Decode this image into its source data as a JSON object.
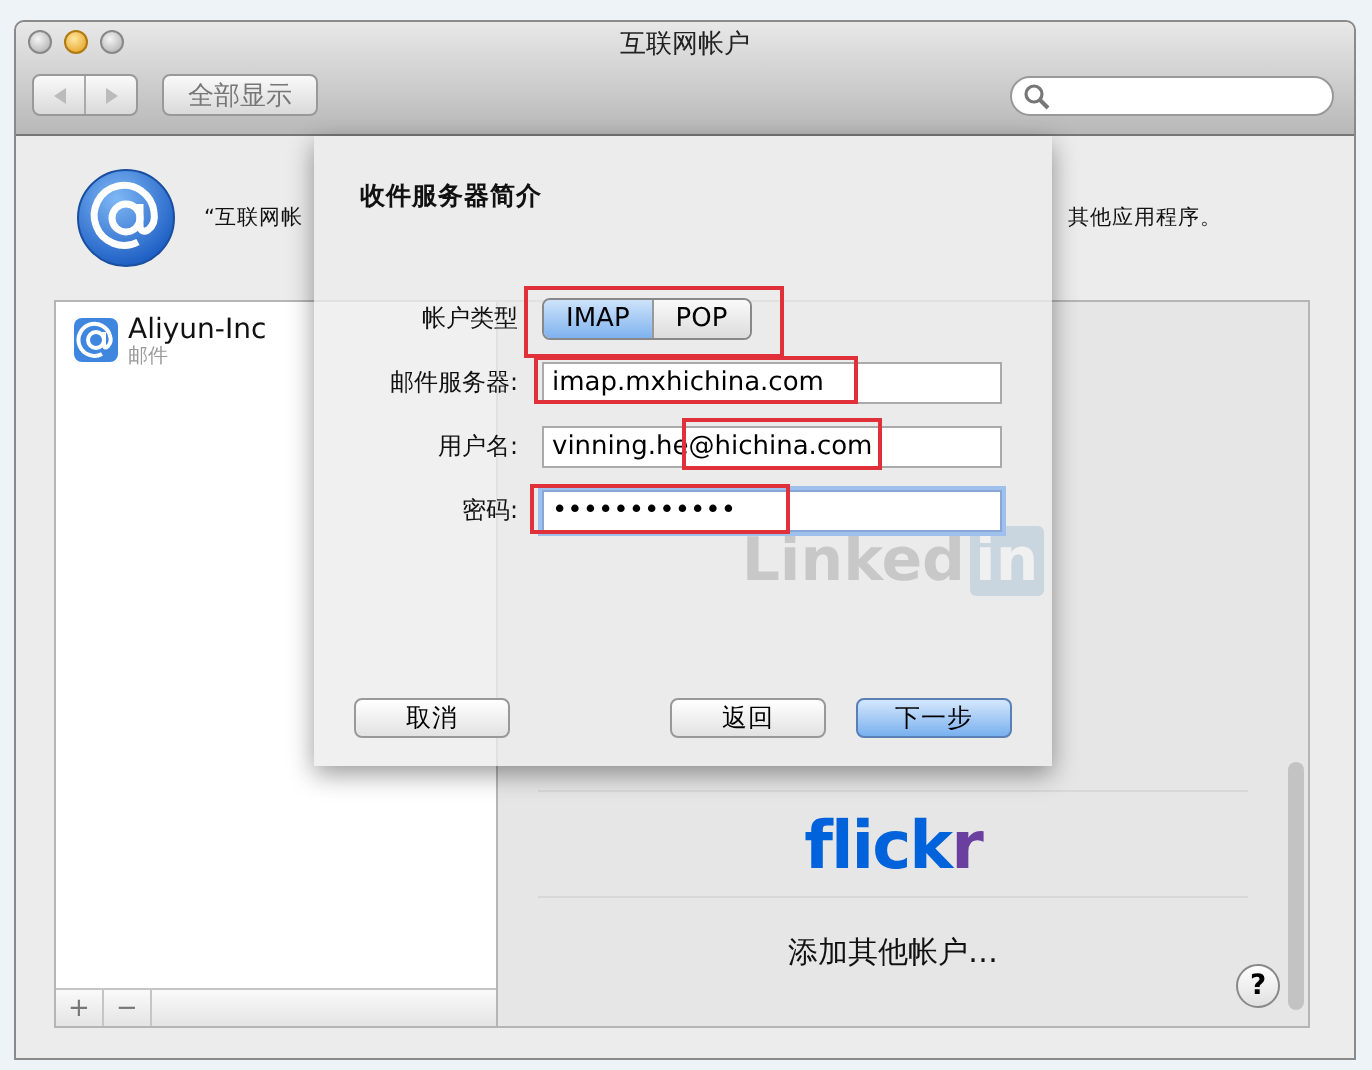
{
  "window": {
    "title": "互联网帐户"
  },
  "toolbar": {
    "show_all": "全部显示"
  },
  "header": {
    "text_left": "“互联网帐",
    "text_right": "其他应用程序。"
  },
  "accounts": [
    {
      "name": "Aliyun-Inc",
      "detail": "邮件",
      "selected": false
    }
  ],
  "list_buttons": [
    "+",
    "−"
  ],
  "providers": [
    {
      "kind": "linkedin",
      "label": "Linked",
      "badge": "in"
    },
    {
      "kind": "flickr",
      "label": "flick",
      "accent": "r"
    },
    {
      "kind": "other",
      "label": "添加其他帐户…"
    }
  ],
  "help": "?",
  "sheet": {
    "title": "收件服务器简介",
    "rows": [
      {
        "kind": "segmented",
        "label": "帐户类型",
        "highlighted": true,
        "options": [
          {
            "label": "IMAP",
            "selected": true
          },
          {
            "label": "POP",
            "selected": false
          }
        ]
      },
      {
        "kind": "text",
        "label": "邮件服务器:",
        "value": "imap.mxhichina.com",
        "highlighted": true,
        "focused": false
      },
      {
        "kind": "text",
        "label": "用户名:",
        "value": "vinning.he@hichina.com",
        "highlighted": true,
        "focused": false
      },
      {
        "kind": "password",
        "label": "密码:",
        "value": "••••••••••••",
        "highlighted": true,
        "focused": true
      }
    ],
    "buttons": [
      {
        "label": "取消",
        "default": false
      },
      {
        "label": "返回",
        "default": false
      },
      {
        "label": "下一步",
        "default": true
      }
    ]
  }
}
